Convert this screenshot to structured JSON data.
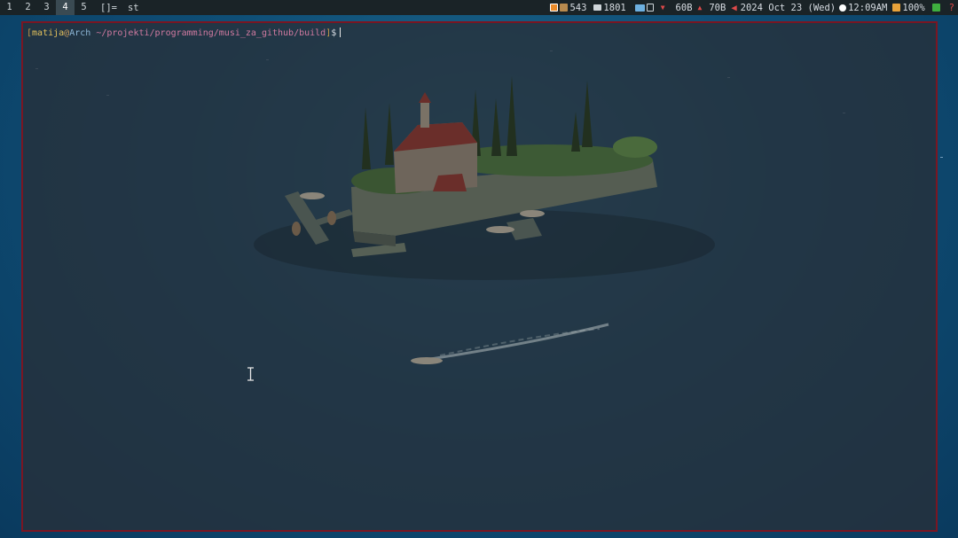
{
  "bar": {
    "workspaces": [
      "1",
      "2",
      "3",
      "4",
      "5"
    ],
    "active_workspace": "4",
    "layout": "[]=",
    "window_title": "st",
    "status": {
      "packages": "543",
      "mail": "1801",
      "net_down": "60B",
      "net_up": "70B",
      "date": "2024 Oct 23 (Wed)",
      "time": "12:09AM",
      "battery": "100%"
    }
  },
  "terminal": {
    "open_bracket": "[",
    "user": "matija",
    "at": "@",
    "host": "Arch",
    "path": "~/projekti/programming/musi_za_github/build",
    "close_bracket": "]",
    "dollar": "$"
  },
  "colors": {
    "bar_bg": "#1a2327",
    "terminal_border": "#7a1622",
    "active_ws": "#3a4a52"
  }
}
